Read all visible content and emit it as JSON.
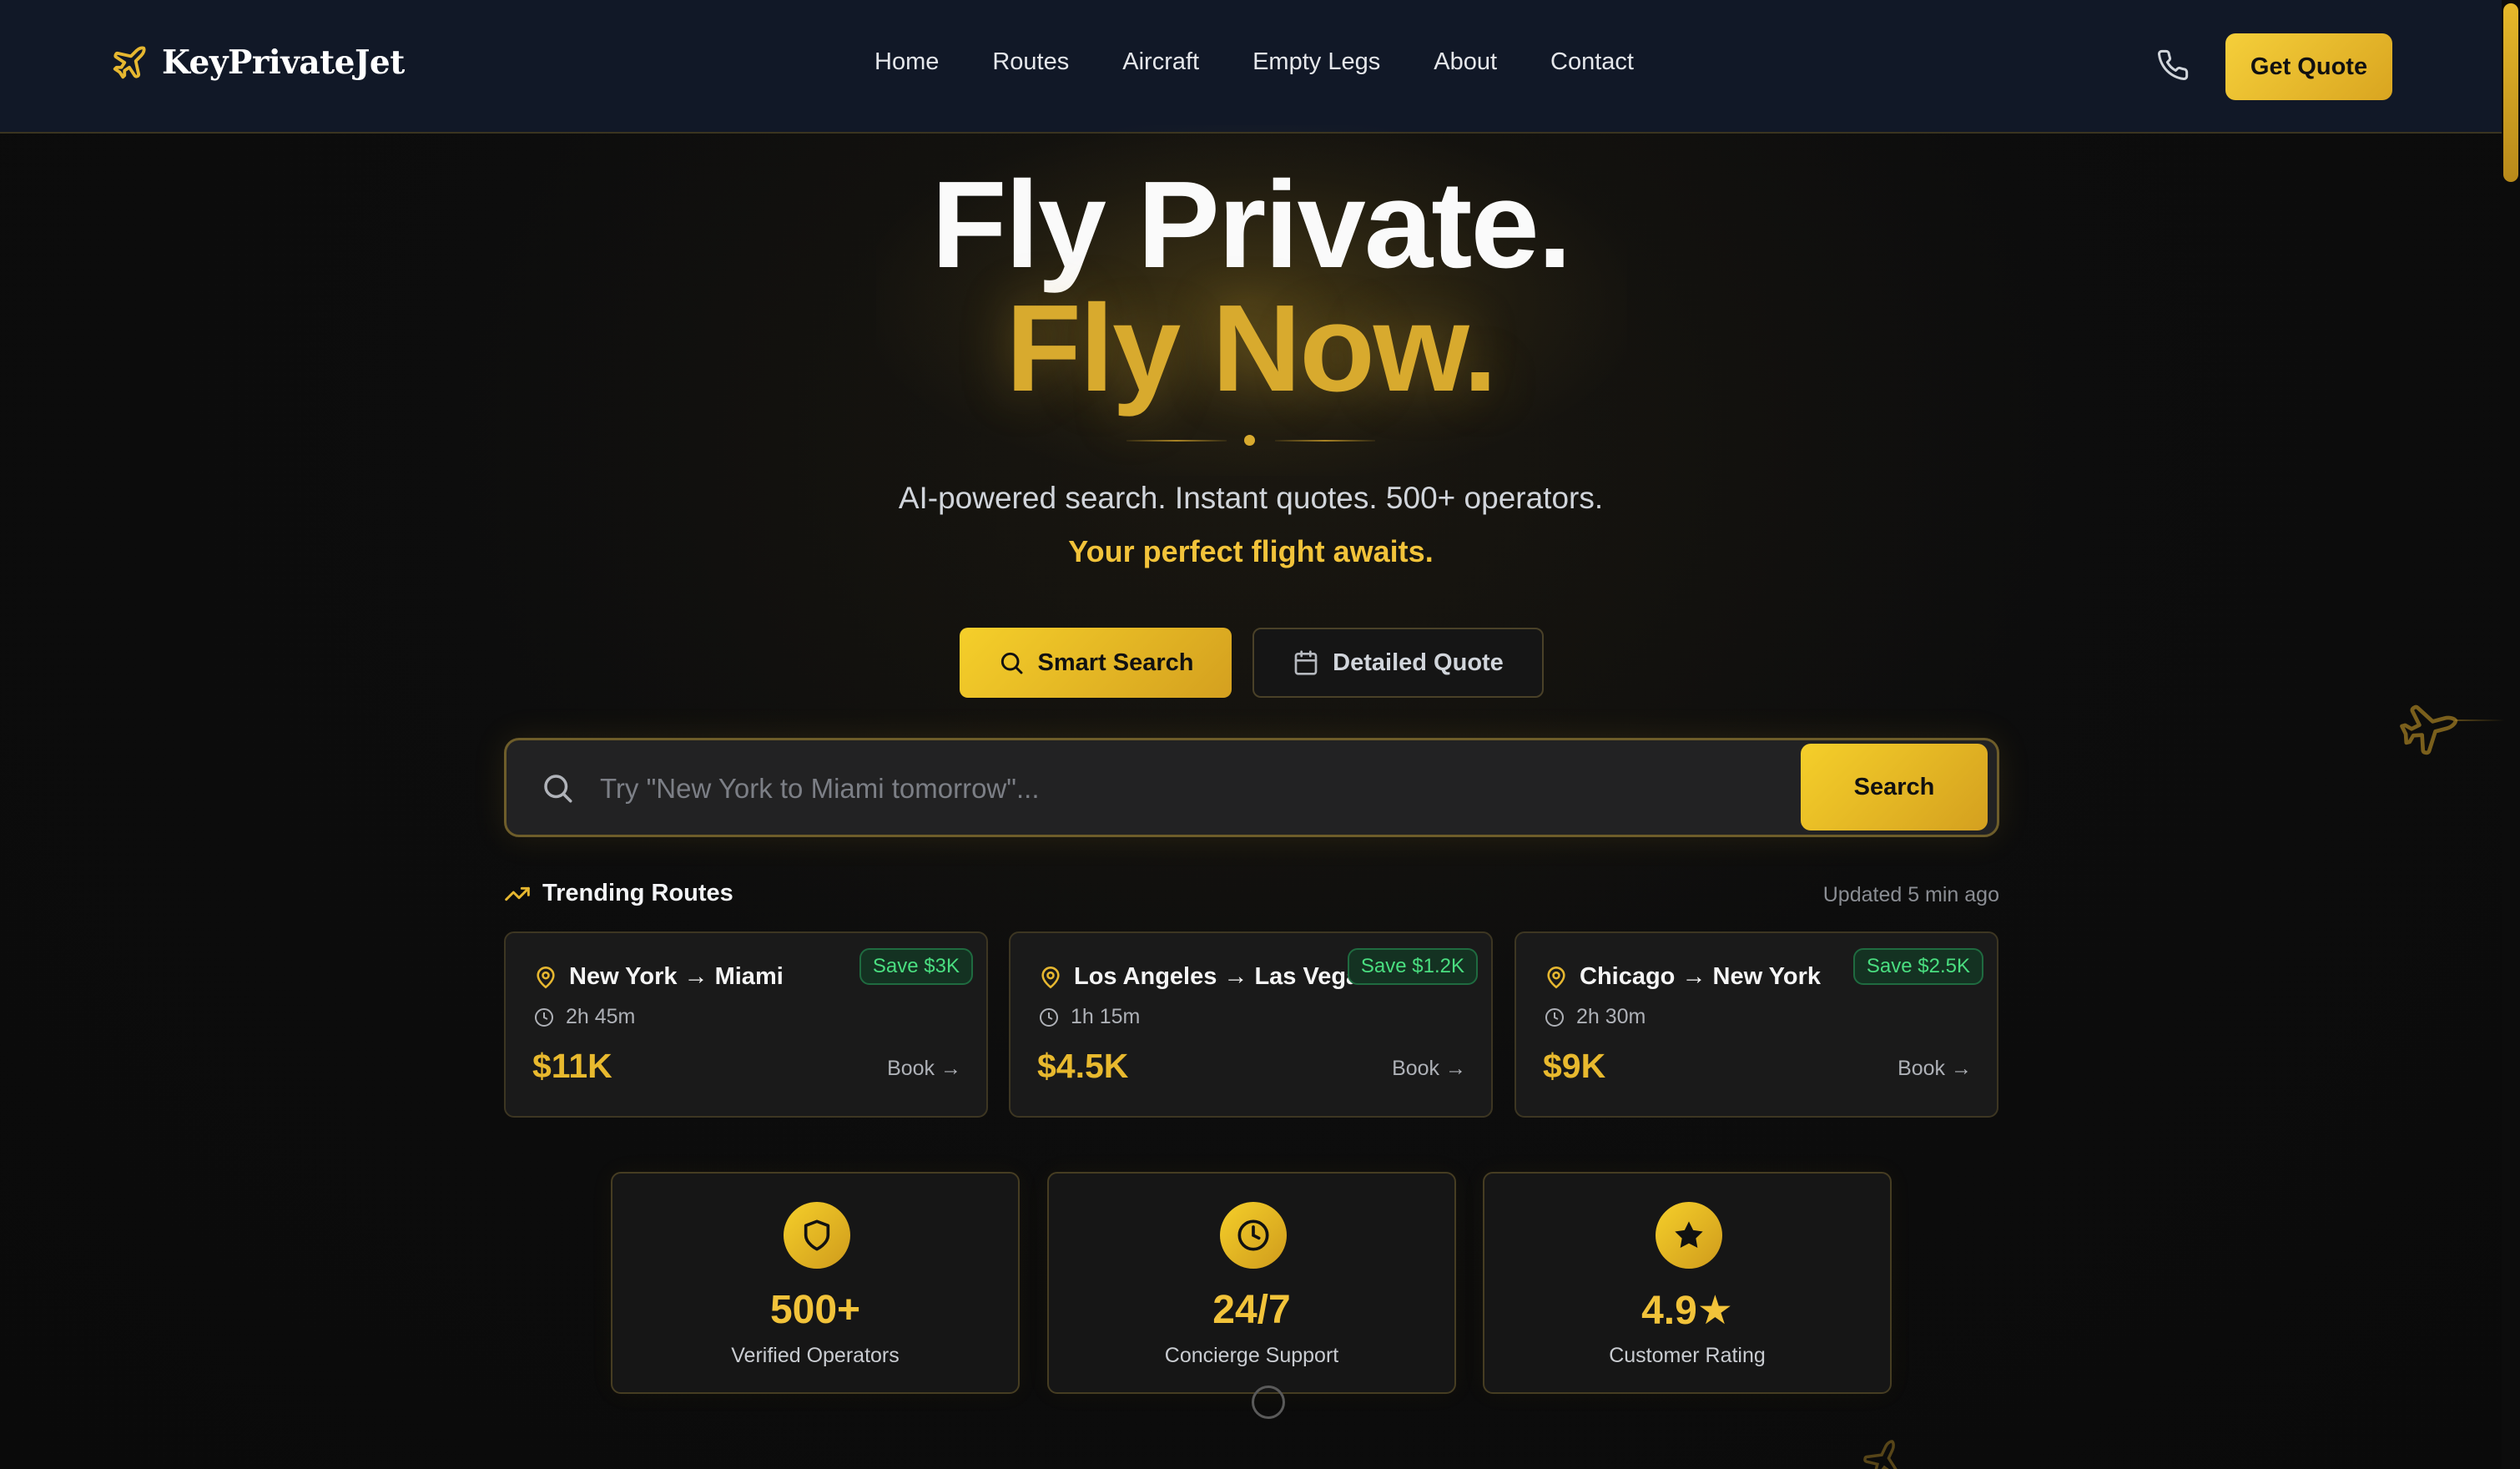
{
  "brand": {
    "name": "KeyPrivateJet",
    "icon": "plane-icon"
  },
  "nav": {
    "links": [
      "Home",
      "Routes",
      "Aircraft",
      "Empty Legs",
      "About",
      "Contact"
    ],
    "phone_icon": "phone-icon",
    "quote_label": "Get Quote"
  },
  "hero": {
    "line1": "Fly Private.",
    "line2": "Fly Now.",
    "subtitle": "AI-powered search. Instant quotes. 500+ operators.",
    "tagline": "Your perfect flight awaits."
  },
  "modes": {
    "smart_label": "Smart Search",
    "detailed_label": "Detailed Quote",
    "active": "Smart Search"
  },
  "search": {
    "placeholder": "Try \"New York to Miami tomorrow\"...",
    "value": "",
    "button_label": "Search"
  },
  "trending": {
    "title": "Trending Routes",
    "updated": "Updated 5 min ago",
    "routes": [
      {
        "route": "New York → Miami",
        "duration": "2h 45m",
        "price": "$11K",
        "save": "Save $3K",
        "book": "Book →"
      },
      {
        "route": "Los Angeles → Las Vegas",
        "duration": "1h 15m",
        "price": "$4.5K",
        "save": "Save $1.2K",
        "book": "Book →"
      },
      {
        "route": "Chicago → New York",
        "duration": "2h 30m",
        "price": "$9K",
        "save": "Save $2.5K",
        "book": "Book →"
      }
    ]
  },
  "stats": [
    {
      "icon": "shield-icon",
      "value": "500+",
      "label": "Verified Operators"
    },
    {
      "icon": "clock-icon",
      "value": "24/7",
      "label": "Concierge Support"
    },
    {
      "icon": "star-icon",
      "value": "4.9★",
      "label": "Customer Rating"
    }
  ],
  "colors": {
    "accent": "#f2c33a",
    "accent_dark": "#d4a01f",
    "nav_bg": "#111827",
    "page_bg": "#0d0d0d",
    "save_green": "#4ade80"
  }
}
